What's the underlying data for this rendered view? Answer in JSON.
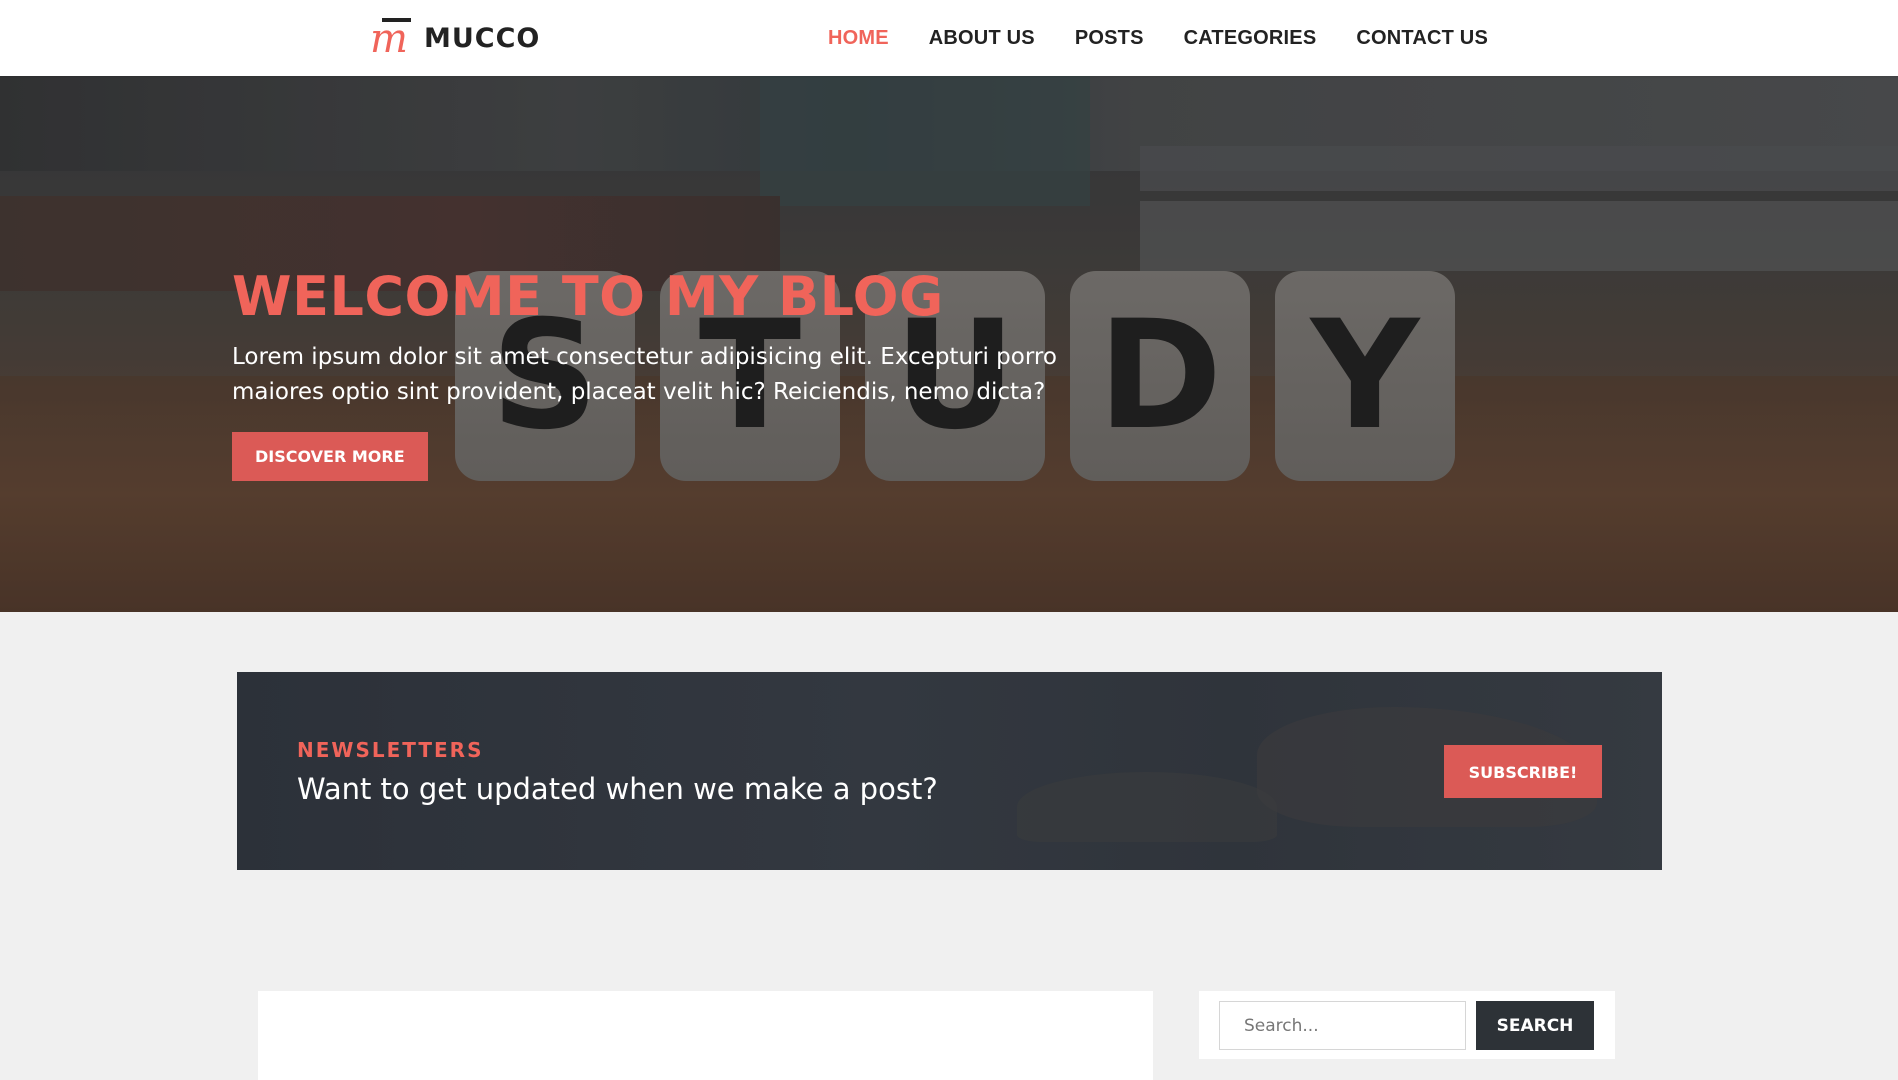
{
  "header": {
    "logo_text": "MUCCO",
    "logo_glyph": "m",
    "nav": [
      {
        "label": "HOME",
        "active": true
      },
      {
        "label": "ABOUT US",
        "active": false
      },
      {
        "label": "POSTS",
        "active": false
      },
      {
        "label": "CATEGORIES",
        "active": false
      },
      {
        "label": "CONTACT US",
        "active": false
      }
    ]
  },
  "hero": {
    "title": "WELCOME TO MY BLOG",
    "text": "Lorem ipsum dolor sit amet consectetur adipisicing elit. Excepturi porro maiores optio sint provident, placeat velit hic? Reiciendis, nemo dicta?",
    "button_label": "DISCOVER MORE",
    "dice_letters": [
      "S",
      "T",
      "U",
      "D",
      "Y"
    ]
  },
  "newsletter": {
    "label": "NEWSLETTERS",
    "text": "Want to get updated when we make a post?",
    "button_label": "SUBSCRIBE!"
  },
  "search": {
    "placeholder": "Search...",
    "value": "",
    "button_label": "SEARCH"
  },
  "colors": {
    "accent": "#f0645a",
    "button": "#db5a56",
    "dark_button": "#2d3237",
    "page_background": "#f0f0f0"
  }
}
